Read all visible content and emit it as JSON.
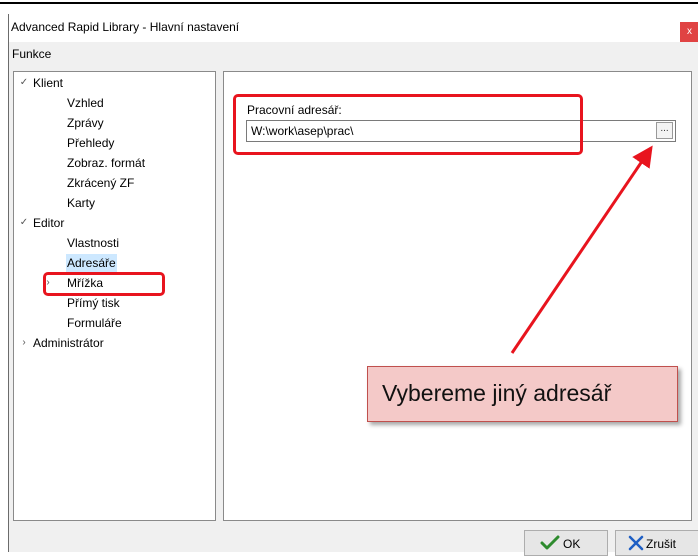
{
  "window": {
    "title": "Advanced Rapid Library - Hlavní nastavení",
    "close_icon": "close-icon"
  },
  "menu": {
    "functions": "Funkce"
  },
  "tree": {
    "nodes": [
      {
        "label": "Klient",
        "level": 0,
        "expander": "expanded"
      },
      {
        "label": "Vzhled",
        "level": 1
      },
      {
        "label": "Zprávy",
        "level": 1
      },
      {
        "label": "Přehledy",
        "level": 1
      },
      {
        "label": "Zobraz. formát",
        "level": 1
      },
      {
        "label": "Zkrácený ZF",
        "level": 1
      },
      {
        "label": "Karty",
        "level": 1
      },
      {
        "label": "Editor",
        "level": 0,
        "expander": "expanded"
      },
      {
        "label": "Vlastnosti",
        "level": 1
      },
      {
        "label": "Adresáře",
        "level": 1,
        "selected": true
      },
      {
        "label": "Mřížka",
        "level": 1,
        "expander": "collapsed"
      },
      {
        "label": "Přímý tisk",
        "level": 1
      },
      {
        "label": "Formuláře",
        "level": 1
      },
      {
        "label": "Administrátor",
        "level": 0,
        "expander": "collapsed"
      }
    ]
  },
  "content": {
    "field_label": "Pracovní adresář:",
    "path_value": "W:\\work\\asep\\prac\\",
    "browse_label": "..."
  },
  "annotation": {
    "callout_text": "Vybereme jiný adresář",
    "highlight_color": "#e8141e",
    "callout_fill": "#f4c9c8"
  },
  "buttons": {
    "ok_label": "OK",
    "cancel_label": "Zrušit"
  },
  "colors": {
    "close_button": "#e04343",
    "selection": "#cde8ff",
    "check_green": "#2e8b2e",
    "cancel_x": "#1f5fc4"
  }
}
